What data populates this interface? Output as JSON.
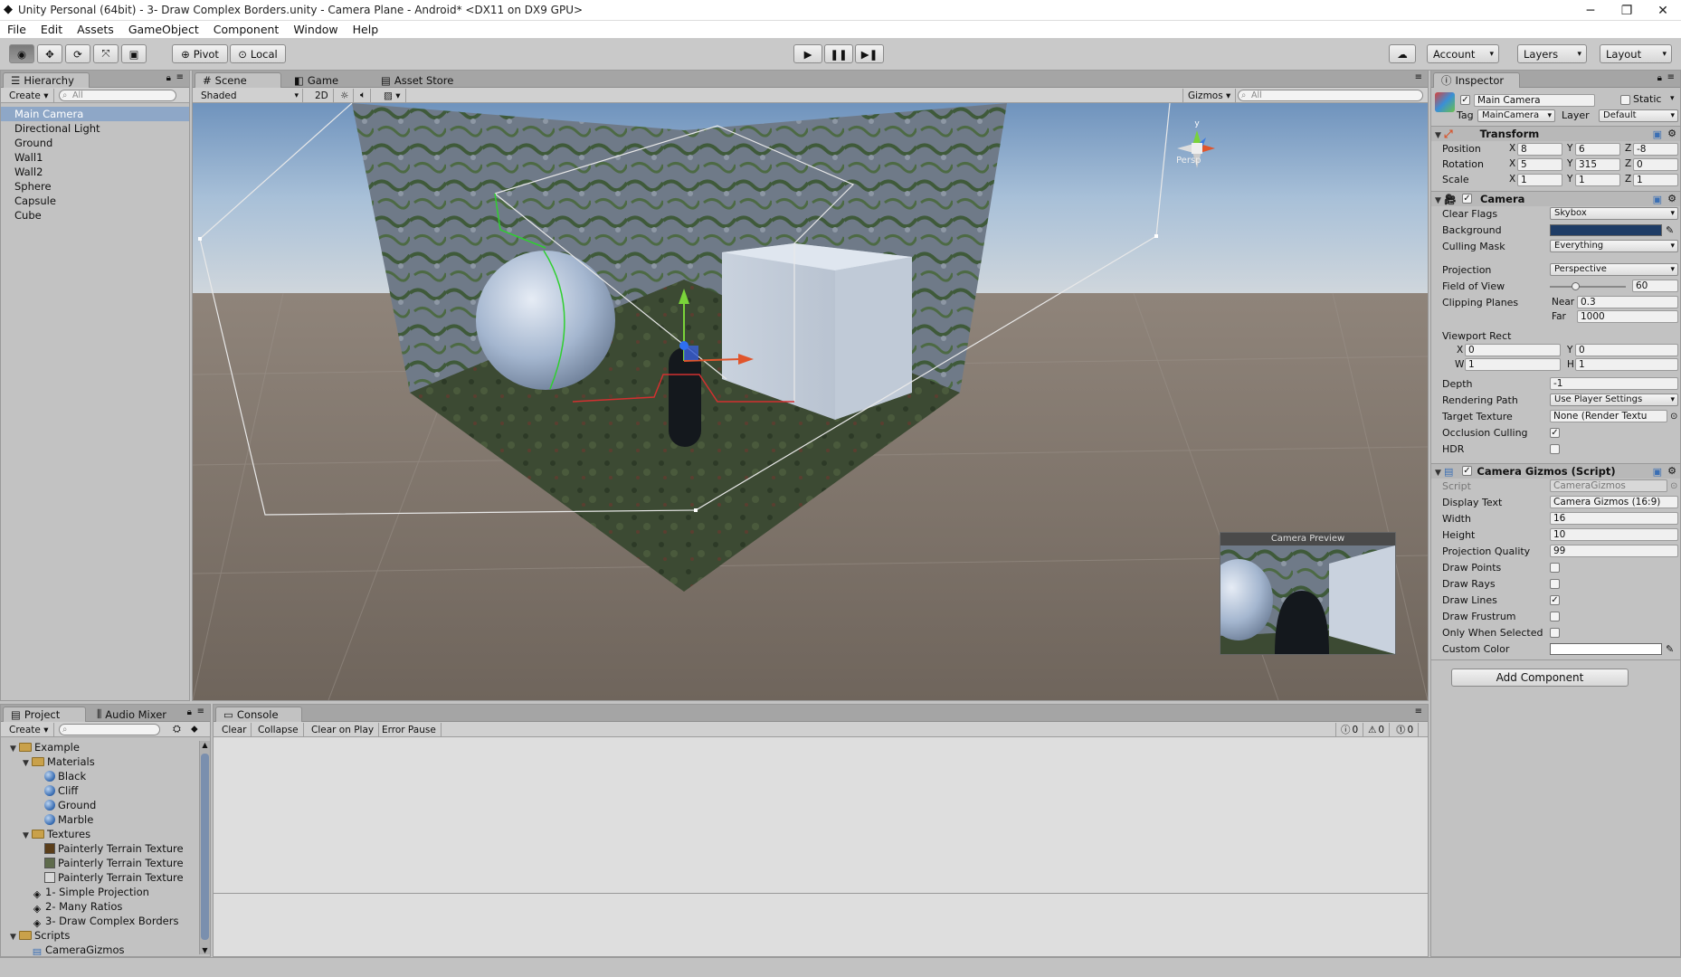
{
  "window": {
    "title": "Unity Personal (64bit) - 3- Draw Complex Borders.unity - Camera Plane - Android* <DX11 on DX9 GPU>"
  },
  "menu": [
    "File",
    "Edit",
    "Assets",
    "GameObject",
    "Component",
    "Window",
    "Help"
  ],
  "toolbar": {
    "pivot": "Pivot",
    "local": "Local",
    "account": "Account",
    "layers": "Layers",
    "layout": "Layout"
  },
  "hierarchy": {
    "tab": "Hierarchy",
    "create": "Create",
    "search_placeholder": "All",
    "items": [
      "Main Camera",
      "Directional Light",
      "Ground",
      "Wall1",
      "Wall2",
      "Sphere",
      "Capsule",
      "Cube"
    ]
  },
  "scene": {
    "tabs": [
      "Scene",
      "Game",
      "Asset Store"
    ],
    "shading": "Shaded",
    "mode_2d": "2D",
    "gizmos": "Gizmos",
    "search_placeholder": "All",
    "persp": "Persp",
    "preview_title": "Camera Preview"
  },
  "inspector": {
    "tab": "Inspector",
    "object_name": "Main Camera",
    "static_label": "Static",
    "tag_label": "Tag",
    "tag": "MainCamera",
    "layer_label": "Layer",
    "layer": "Default",
    "transform": {
      "title": "Transform",
      "position_label": "Position",
      "rotation_label": "Rotation",
      "scale_label": "Scale",
      "position": [
        "8",
        "6",
        "-8"
      ],
      "rotation": [
        "5",
        "315",
        "0"
      ],
      "scale": [
        "1",
        "1",
        "1"
      ]
    },
    "camera": {
      "title": "Camera",
      "clear_flags_label": "Clear Flags",
      "clear_flags": "Skybox",
      "background_label": "Background",
      "culling_mask_label": "Culling Mask",
      "culling_mask": "Everything",
      "projection_label": "Projection",
      "projection": "Perspective",
      "fov_label": "Field of View",
      "fov": "60",
      "clipping_label": "Clipping Planes",
      "near_label": "Near",
      "near": "0.3",
      "far_label": "Far",
      "far": "1000",
      "viewport_label": "Viewport Rect",
      "vx": "0",
      "vy": "0",
      "vw": "1",
      "vh": "1",
      "depth_label": "Depth",
      "depth": "-1",
      "rendering_label": "Rendering Path",
      "rendering": "Use Player Settings",
      "target_label": "Target Texture",
      "target": "None (Render Textu",
      "occlusion_label": "Occlusion Culling",
      "hdr_label": "HDR"
    },
    "gizmos": {
      "title": "Camera Gizmos (Script)",
      "script_label": "Script",
      "script": "CameraGizmos",
      "display_text_label": "Display Text",
      "display_text": "Camera Gizmos (16:9)",
      "width_label": "Width",
      "width": "16",
      "height_label": "Height",
      "height": "10",
      "quality_label": "Projection Quality",
      "quality": "99",
      "draw_points_label": "Draw Points",
      "draw_rays_label": "Draw Rays",
      "draw_lines_label": "Draw Lines",
      "draw_frustum_label": "Draw Frustrum",
      "only_selected_label": "Only When Selected",
      "custom_color_label": "Custom Color"
    },
    "add_component": "Add Component"
  },
  "project": {
    "tabs": [
      "Project",
      "Audio Mixer"
    ],
    "create": "Create",
    "tree": [
      {
        "label": "Example",
        "depth": 0,
        "kind": "folder"
      },
      {
        "label": "Materials",
        "depth": 1,
        "kind": "folder"
      },
      {
        "label": "Black",
        "depth": 2,
        "kind": "mat"
      },
      {
        "label": "Cliff",
        "depth": 2,
        "kind": "mat"
      },
      {
        "label": "Ground",
        "depth": 2,
        "kind": "mat"
      },
      {
        "label": "Marble",
        "depth": 2,
        "kind": "mat"
      },
      {
        "label": "Textures",
        "depth": 1,
        "kind": "folder"
      },
      {
        "label": "Painterly Terrain Texture",
        "depth": 2,
        "kind": "tex1"
      },
      {
        "label": "Painterly Terrain Texture",
        "depth": 2,
        "kind": "tex2"
      },
      {
        "label": "Painterly Terrain Texture",
        "depth": 2,
        "kind": "tex3"
      },
      {
        "label": "1- Simple Projection",
        "depth": 1,
        "kind": "unity"
      },
      {
        "label": "2- Many Ratios",
        "depth": 1,
        "kind": "unity"
      },
      {
        "label": "3- Draw Complex Borders",
        "depth": 1,
        "kind": "unity"
      },
      {
        "label": "Scripts",
        "depth": 0,
        "kind": "folder"
      },
      {
        "label": "CameraGizmos",
        "depth": 1,
        "kind": "script"
      }
    ]
  },
  "console": {
    "tab": "Console",
    "buttons": [
      "Clear",
      "Collapse",
      "Clear on Play",
      "Error Pause"
    ],
    "counts": [
      "0",
      "0",
      "0"
    ]
  }
}
